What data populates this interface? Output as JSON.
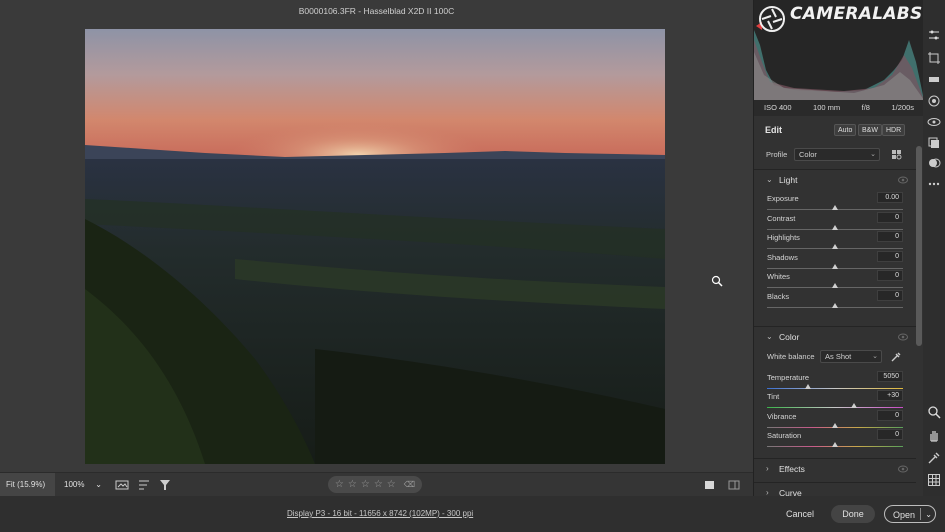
{
  "window": {
    "title": "B0000106.3FR  -  Hasselblad X2D II 100C"
  },
  "watermark": {
    "text": "CAMERALABS.COM"
  },
  "exif": {
    "iso": "ISO 400",
    "focal": "100 mm",
    "aperture": "f/8",
    "shutter": "1/200s"
  },
  "edit": {
    "title": "Edit",
    "auto": "Auto",
    "bw": "B&W",
    "hdr": "HDR",
    "profile_label": "Profile",
    "profile_value": "Color"
  },
  "light": {
    "title": "Light",
    "sliders": [
      {
        "label": "Exposure",
        "value": "0.00",
        "position": 0.5
      },
      {
        "label": "Contrast",
        "value": "0",
        "position": 0.5
      },
      {
        "label": "Highlights",
        "value": "0",
        "position": 0.5
      },
      {
        "label": "Shadows",
        "value": "0",
        "position": 0.5
      },
      {
        "label": "Whites",
        "value": "0",
        "position": 0.5
      },
      {
        "label": "Blacks",
        "value": "0",
        "position": 0.5
      }
    ]
  },
  "color": {
    "title": "Color",
    "wb_label": "White balance",
    "wb_value": "As Shot",
    "sliders": [
      {
        "label": "Temperature",
        "value": "5050",
        "position": 0.3
      },
      {
        "label": "Tint",
        "value": "+30",
        "position": 0.64
      },
      {
        "label": "Vibrance",
        "value": "0",
        "position": 0.5
      },
      {
        "label": "Saturation",
        "value": "0",
        "position": 0.5
      }
    ]
  },
  "effects": {
    "title": "Effects"
  },
  "curve": {
    "title": "Curve"
  },
  "bottombar": {
    "fit": "Fit (15.9%)",
    "zoom": "100%"
  },
  "footer": {
    "info": "Display P3 - 16 bit - 11656 x 8742 (102MP) - 300 ppi",
    "cancel": "Cancel",
    "done": "Done",
    "open": "Open"
  }
}
